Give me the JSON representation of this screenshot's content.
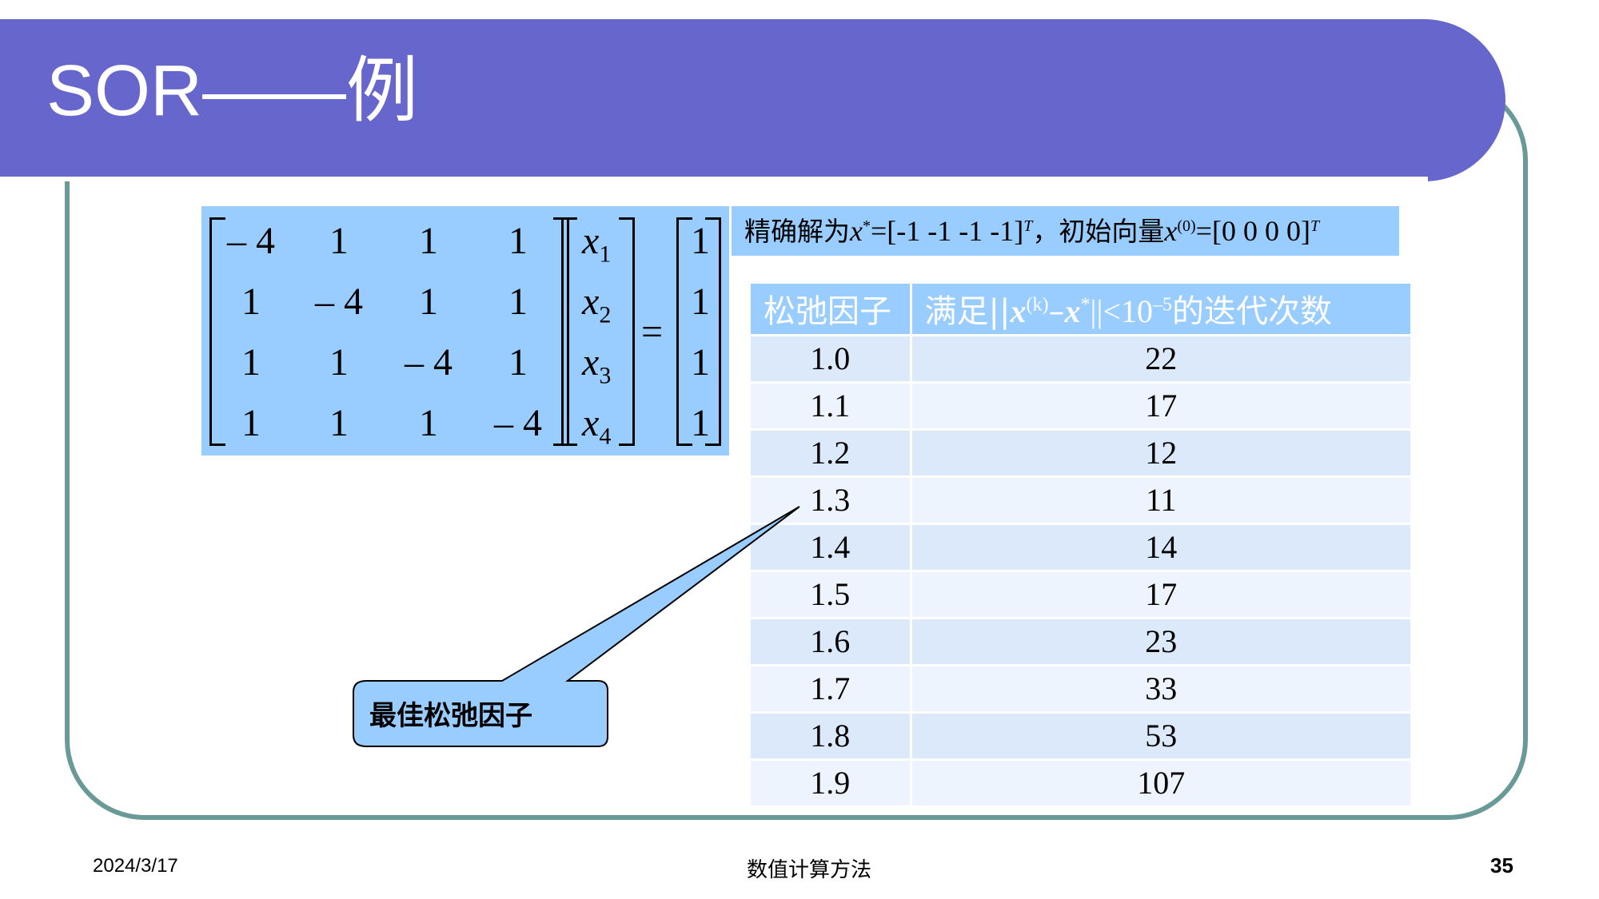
{
  "slide": {
    "title": "SOR——例"
  },
  "matrix": {
    "A": [
      [
        "– 4",
        "1",
        "1",
        "1"
      ],
      [
        "1",
        "– 4",
        "1",
        "1"
      ],
      [
        "1",
        "1",
        "– 4",
        "1"
      ],
      [
        "1",
        "1",
        "1",
        "– 4"
      ]
    ],
    "x": [
      "x",
      "x",
      "x",
      "x"
    ],
    "x_subscripts": [
      "1",
      "2",
      "3",
      "4"
    ],
    "equals": "=",
    "b": [
      "1",
      "1",
      "1",
      "1"
    ]
  },
  "info": {
    "exact_label": "精确解为",
    "exact_var": "x",
    "exact_sup": "*",
    "exact_value": "=[-1 -1 -1 -1]",
    "exact_T": "T",
    "comma": "，",
    "init_label": "初始向量",
    "init_var": "x",
    "init_sup": "(0)",
    "init_value": "=[0 0 0 0]",
    "init_T": "T"
  },
  "table": {
    "col1_header": "松弛因子",
    "col2_prefix": "满足||",
    "col2_x1": "x",
    "col2_sup1": "(k)",
    "col2_minus": "–",
    "col2_x2": "x",
    "col2_sup2": "*",
    "col2_norm": "||<10",
    "col2_exp": "–5",
    "col2_suffix": "的迭代次数",
    "rows": [
      {
        "omega": "1.0",
        "iterations": "22"
      },
      {
        "omega": "1.1",
        "iterations": "17"
      },
      {
        "omega": "1.2",
        "iterations": "12"
      },
      {
        "omega": "1.3",
        "iterations": "11"
      },
      {
        "omega": "1.4",
        "iterations": "14"
      },
      {
        "omega": "1.5",
        "iterations": "17"
      },
      {
        "omega": "1.6",
        "iterations": "23"
      },
      {
        "omega": "1.7",
        "iterations": "33"
      },
      {
        "omega": "1.8",
        "iterations": "53"
      },
      {
        "omega": "1.9",
        "iterations": "107"
      }
    ]
  },
  "callout": {
    "label": "最佳松弛因子"
  },
  "footer": {
    "date": "2024/3/17",
    "course": "数值计算方法",
    "page": "35"
  },
  "colors": {
    "title_bar": "#6666cc",
    "frame": "#6a9a98",
    "panel": "#99ccff",
    "row_odd": "#dce9fb",
    "row_even": "#eef4fd"
  }
}
